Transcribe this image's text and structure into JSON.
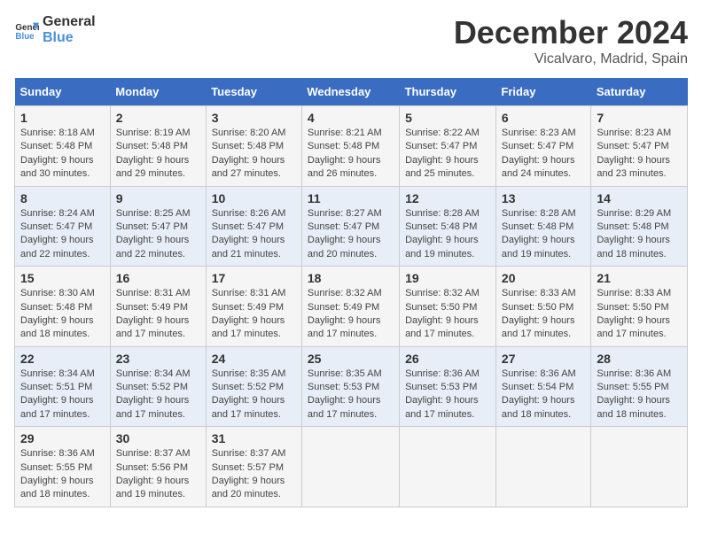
{
  "header": {
    "logo_general": "General",
    "logo_blue": "Blue",
    "month": "December 2024",
    "location": "Vicalvaro, Madrid, Spain"
  },
  "weekdays": [
    "Sunday",
    "Monday",
    "Tuesday",
    "Wednesday",
    "Thursday",
    "Friday",
    "Saturday"
  ],
  "weeks": [
    [
      {
        "day": "1",
        "text": "Sunrise: 8:18 AM\nSunset: 5:48 PM\nDaylight: 9 hours and 30 minutes."
      },
      {
        "day": "2",
        "text": "Sunrise: 8:19 AM\nSunset: 5:48 PM\nDaylight: 9 hours and 29 minutes."
      },
      {
        "day": "3",
        "text": "Sunrise: 8:20 AM\nSunset: 5:48 PM\nDaylight: 9 hours and 27 minutes."
      },
      {
        "day": "4",
        "text": "Sunrise: 8:21 AM\nSunset: 5:48 PM\nDaylight: 9 hours and 26 minutes."
      },
      {
        "day": "5",
        "text": "Sunrise: 8:22 AM\nSunset: 5:47 PM\nDaylight: 9 hours and 25 minutes."
      },
      {
        "day": "6",
        "text": "Sunrise: 8:23 AM\nSunset: 5:47 PM\nDaylight: 9 hours and 24 minutes."
      },
      {
        "day": "7",
        "text": "Sunrise: 8:23 AM\nSunset: 5:47 PM\nDaylight: 9 hours and 23 minutes."
      }
    ],
    [
      {
        "day": "8",
        "text": "Sunrise: 8:24 AM\nSunset: 5:47 PM\nDaylight: 9 hours and 22 minutes."
      },
      {
        "day": "9",
        "text": "Sunrise: 8:25 AM\nSunset: 5:47 PM\nDaylight: 9 hours and 22 minutes."
      },
      {
        "day": "10",
        "text": "Sunrise: 8:26 AM\nSunset: 5:47 PM\nDaylight: 9 hours and 21 minutes."
      },
      {
        "day": "11",
        "text": "Sunrise: 8:27 AM\nSunset: 5:47 PM\nDaylight: 9 hours and 20 minutes."
      },
      {
        "day": "12",
        "text": "Sunrise: 8:28 AM\nSunset: 5:48 PM\nDaylight: 9 hours and 19 minutes."
      },
      {
        "day": "13",
        "text": "Sunrise: 8:28 AM\nSunset: 5:48 PM\nDaylight: 9 hours and 19 minutes."
      },
      {
        "day": "14",
        "text": "Sunrise: 8:29 AM\nSunset: 5:48 PM\nDaylight: 9 hours and 18 minutes."
      }
    ],
    [
      {
        "day": "15",
        "text": "Sunrise: 8:30 AM\nSunset: 5:48 PM\nDaylight: 9 hours and 18 minutes."
      },
      {
        "day": "16",
        "text": "Sunrise: 8:31 AM\nSunset: 5:49 PM\nDaylight: 9 hours and 17 minutes."
      },
      {
        "day": "17",
        "text": "Sunrise: 8:31 AM\nSunset: 5:49 PM\nDaylight: 9 hours and 17 minutes."
      },
      {
        "day": "18",
        "text": "Sunrise: 8:32 AM\nSunset: 5:49 PM\nDaylight: 9 hours and 17 minutes."
      },
      {
        "day": "19",
        "text": "Sunrise: 8:32 AM\nSunset: 5:50 PM\nDaylight: 9 hours and 17 minutes."
      },
      {
        "day": "20",
        "text": "Sunrise: 8:33 AM\nSunset: 5:50 PM\nDaylight: 9 hours and 17 minutes."
      },
      {
        "day": "21",
        "text": "Sunrise: 8:33 AM\nSunset: 5:50 PM\nDaylight: 9 hours and 17 minutes."
      }
    ],
    [
      {
        "day": "22",
        "text": "Sunrise: 8:34 AM\nSunset: 5:51 PM\nDaylight: 9 hours and 17 minutes."
      },
      {
        "day": "23",
        "text": "Sunrise: 8:34 AM\nSunset: 5:52 PM\nDaylight: 9 hours and 17 minutes."
      },
      {
        "day": "24",
        "text": "Sunrise: 8:35 AM\nSunset: 5:52 PM\nDaylight: 9 hours and 17 minutes."
      },
      {
        "day": "25",
        "text": "Sunrise: 8:35 AM\nSunset: 5:53 PM\nDaylight: 9 hours and 17 minutes."
      },
      {
        "day": "26",
        "text": "Sunrise: 8:36 AM\nSunset: 5:53 PM\nDaylight: 9 hours and 17 minutes."
      },
      {
        "day": "27",
        "text": "Sunrise: 8:36 AM\nSunset: 5:54 PM\nDaylight: 9 hours and 18 minutes."
      },
      {
        "day": "28",
        "text": "Sunrise: 8:36 AM\nSunset: 5:55 PM\nDaylight: 9 hours and 18 minutes."
      }
    ],
    [
      {
        "day": "29",
        "text": "Sunrise: 8:36 AM\nSunset: 5:55 PM\nDaylight: 9 hours and 18 minutes."
      },
      {
        "day": "30",
        "text": "Sunrise: 8:37 AM\nSunset: 5:56 PM\nDaylight: 9 hours and 19 minutes."
      },
      {
        "day": "31",
        "text": "Sunrise: 8:37 AM\nSunset: 5:57 PM\nDaylight: 9 hours and 20 minutes."
      },
      {
        "day": "",
        "text": ""
      },
      {
        "day": "",
        "text": ""
      },
      {
        "day": "",
        "text": ""
      },
      {
        "day": "",
        "text": ""
      }
    ]
  ]
}
